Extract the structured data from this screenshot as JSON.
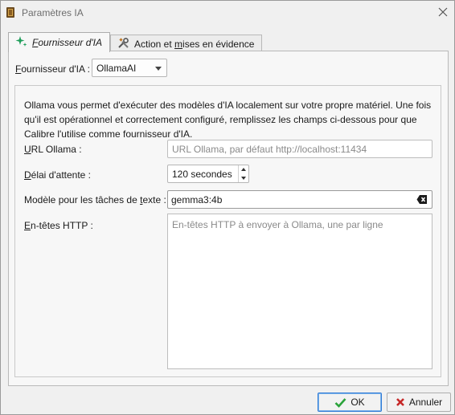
{
  "window": {
    "title": "Paramètres IA"
  },
  "tabs": [
    {
      "label_pre": "",
      "label_u": "F",
      "label_post": "ournisseur d'IA",
      "icon": "sparkle-icon"
    },
    {
      "label_pre": "Action et ",
      "label_u": "m",
      "label_post": "ises en évidence",
      "icon": "tools-icon"
    }
  ],
  "provider": {
    "label_u": "F",
    "label_rest": "ournisseur d'IA :",
    "value": "OllamaAI"
  },
  "description": "Ollama vous permet d'exécuter des modèles d'IA localement sur votre propre matériel. Une fois qu'il est opérationnel et correctement configuré, remplissez les champs ci-dessous pour que Calibre l'utilise comme fournisseur d'IA.",
  "fields": {
    "url": {
      "label_u": "U",
      "label_rest": "RL Ollama :",
      "value": "",
      "placeholder": "URL Ollama, par défaut http://localhost:11434"
    },
    "timeout": {
      "label_u": "D",
      "label_rest": "élai d'attente :",
      "value": "120 secondes"
    },
    "model": {
      "label_pre": "Modèle pour les tâches de ",
      "label_u": "t",
      "label_post": "exte :",
      "value": "gemma3:4b"
    },
    "headers": {
      "label_u": "E",
      "label_rest": "n-têtes HTTP :",
      "value": "",
      "placeholder": "En-têtes HTTP à envoyer à Ollama, une par ligne"
    }
  },
  "buttons": {
    "ok": "OK",
    "cancel": "Annuler"
  },
  "colors": {
    "ok_check": "#2aa33a",
    "cancel_x": "#c62828",
    "sparkle": "#1f9e5a"
  }
}
